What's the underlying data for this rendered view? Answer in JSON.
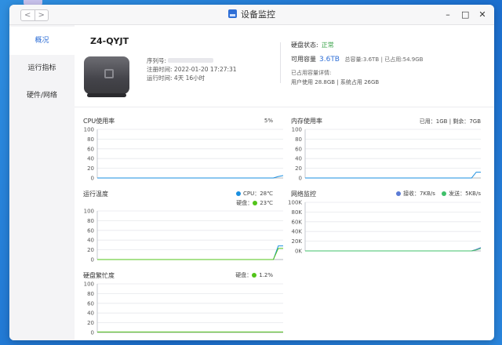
{
  "window": {
    "title": "设备监控",
    "nav_back": "<",
    "nav_forward": ">",
    "ctrl_minimize": "–",
    "ctrl_maximize": "□",
    "ctrl_close": "✕"
  },
  "sidebar": {
    "items": [
      {
        "label": "概况",
        "active": true
      },
      {
        "label": "运行指标",
        "active": false
      },
      {
        "label": "硬件/网络",
        "active": false
      }
    ]
  },
  "device": {
    "name": "Z4-QYJT",
    "serial_label": "序列号:",
    "register_label": "注册时间:",
    "register_value": "2022-01-20 17:27:31",
    "uptime_label": "运行时间:",
    "uptime_value": "4天 16小时"
  },
  "disk": {
    "status_label": "硬盘状态:",
    "status_value": "正常",
    "available_label": "可用容量",
    "available_value": "3.6TB",
    "total_label": "总容量:",
    "total_value": "3.6TB",
    "used_label": "已占用:",
    "used_value": "54.9GB",
    "used_detail_title": "已占用容量详情:",
    "user_used_label": "用户使用",
    "user_used_value": "28.8GB",
    "system_used_label": "系统占用",
    "system_used_value": "26GB"
  },
  "colors": {
    "accent": "#2f6fd6",
    "ok": "#3aa34a",
    "cpu_line": "#1a8fe0",
    "disk_line": "#52c41a",
    "memory_line": "#1a8fe0",
    "net_rx": "#5b7bd5",
    "net_tx": "#3fc06a"
  },
  "charts": {
    "cpu": {
      "title": "CPU使用率",
      "value_text": "5%",
      "yticks": [
        "100",
        "80",
        "60",
        "40",
        "20",
        "0"
      ],
      "series": [
        {
          "name": "CPU",
          "color": "#1a8fe0",
          "values": [
            0,
            0,
            0,
            0,
            0,
            0,
            0,
            0,
            0,
            0,
            0,
            0,
            0,
            0,
            0,
            0,
            0,
            0,
            0,
            0,
            0,
            0,
            0,
            0,
            0,
            0,
            0,
            0,
            0,
            0,
            0,
            0,
            0,
            0,
            0,
            0,
            0,
            3,
            5
          ]
        }
      ]
    },
    "memory": {
      "title": "内存使用率",
      "used_label": "已用：",
      "used_value": "1GB",
      "free_label": "剩余：",
      "free_value": "7GB",
      "yticks": [
        "100",
        "80",
        "60",
        "40",
        "20",
        "0"
      ],
      "series": [
        {
          "name": "内存",
          "color": "#1a8fe0",
          "values": [
            0,
            0,
            0,
            0,
            0,
            0,
            0,
            0,
            0,
            0,
            0,
            0,
            0,
            0,
            0,
            0,
            0,
            0,
            0,
            0,
            0,
            0,
            0,
            0,
            0,
            0,
            0,
            0,
            0,
            0,
            0,
            0,
            0,
            0,
            0,
            0,
            0,
            12,
            12
          ]
        }
      ]
    },
    "temperature": {
      "title": "运行温度",
      "cpu_label": "CPU：",
      "cpu_value": "28℃",
      "disk_label": "硬盘：",
      "disk_value": "23℃",
      "yticks": [
        "100",
        "80",
        "60",
        "40",
        "20",
        "0"
      ],
      "series": [
        {
          "name": "CPU",
          "color": "#1a8fe0",
          "values": [
            0,
            0,
            0,
            0,
            0,
            0,
            0,
            0,
            0,
            0,
            0,
            0,
            0,
            0,
            0,
            0,
            0,
            0,
            0,
            0,
            0,
            0,
            0,
            0,
            0,
            0,
            0,
            0,
            0,
            0,
            0,
            0,
            0,
            0,
            0,
            0,
            0,
            28,
            28
          ]
        },
        {
          "name": "硬盘",
          "color": "#52c41a",
          "values": [
            0,
            0,
            0,
            0,
            0,
            0,
            0,
            0,
            0,
            0,
            0,
            0,
            0,
            0,
            0,
            0,
            0,
            0,
            0,
            0,
            0,
            0,
            0,
            0,
            0,
            0,
            0,
            0,
            0,
            0,
            0,
            0,
            0,
            0,
            0,
            0,
            0,
            23,
            23
          ]
        }
      ]
    },
    "network": {
      "title": "网络监控",
      "rx_label": "接收：",
      "rx_value": "7KB/s",
      "tx_label": "发送：",
      "tx_value": "5KB/s",
      "yticks": [
        "100K",
        "80K",
        "60K",
        "40K",
        "20K",
        "0K"
      ],
      "series": [
        {
          "name": "接收",
          "color": "#5b7bd5",
          "values": [
            0,
            0,
            0,
            0,
            0,
            0,
            0,
            0,
            0,
            0,
            0,
            0,
            0,
            0,
            0,
            0,
            0,
            0,
            0,
            0,
            0,
            0,
            0,
            0,
            0,
            0,
            0,
            0,
            0,
            0,
            0,
            0,
            0,
            0,
            0,
            0,
            0,
            3,
            7
          ]
        },
        {
          "name": "发送",
          "color": "#3fc06a",
          "values": [
            0,
            0,
            0,
            0,
            0,
            0,
            0,
            0,
            0,
            0,
            0,
            0,
            0,
            0,
            0,
            0,
            0,
            0,
            0,
            0,
            0,
            0,
            0,
            0,
            0,
            0,
            0,
            0,
            0,
            0,
            0,
            0,
            0,
            0,
            0,
            0,
            0,
            2,
            5
          ]
        }
      ]
    },
    "disk_busy": {
      "title": "硬盘繁忙度",
      "disk_label": "硬盘：",
      "disk_value": "1.2%",
      "yticks": [
        "100",
        "80",
        "60",
        "40",
        "20",
        "0"
      ],
      "series": [
        {
          "name": "硬盘",
          "color": "#52c41a",
          "values": [
            1,
            1,
            1,
            1,
            1,
            1,
            1,
            1,
            1,
            1,
            1,
            1,
            1,
            1,
            1,
            1,
            1,
            1,
            1,
            1,
            1,
            1,
            1,
            1,
            1,
            1,
            1,
            1,
            1,
            1,
            1,
            1,
            1,
            1,
            1,
            1,
            1,
            1,
            1
          ]
        }
      ]
    }
  }
}
